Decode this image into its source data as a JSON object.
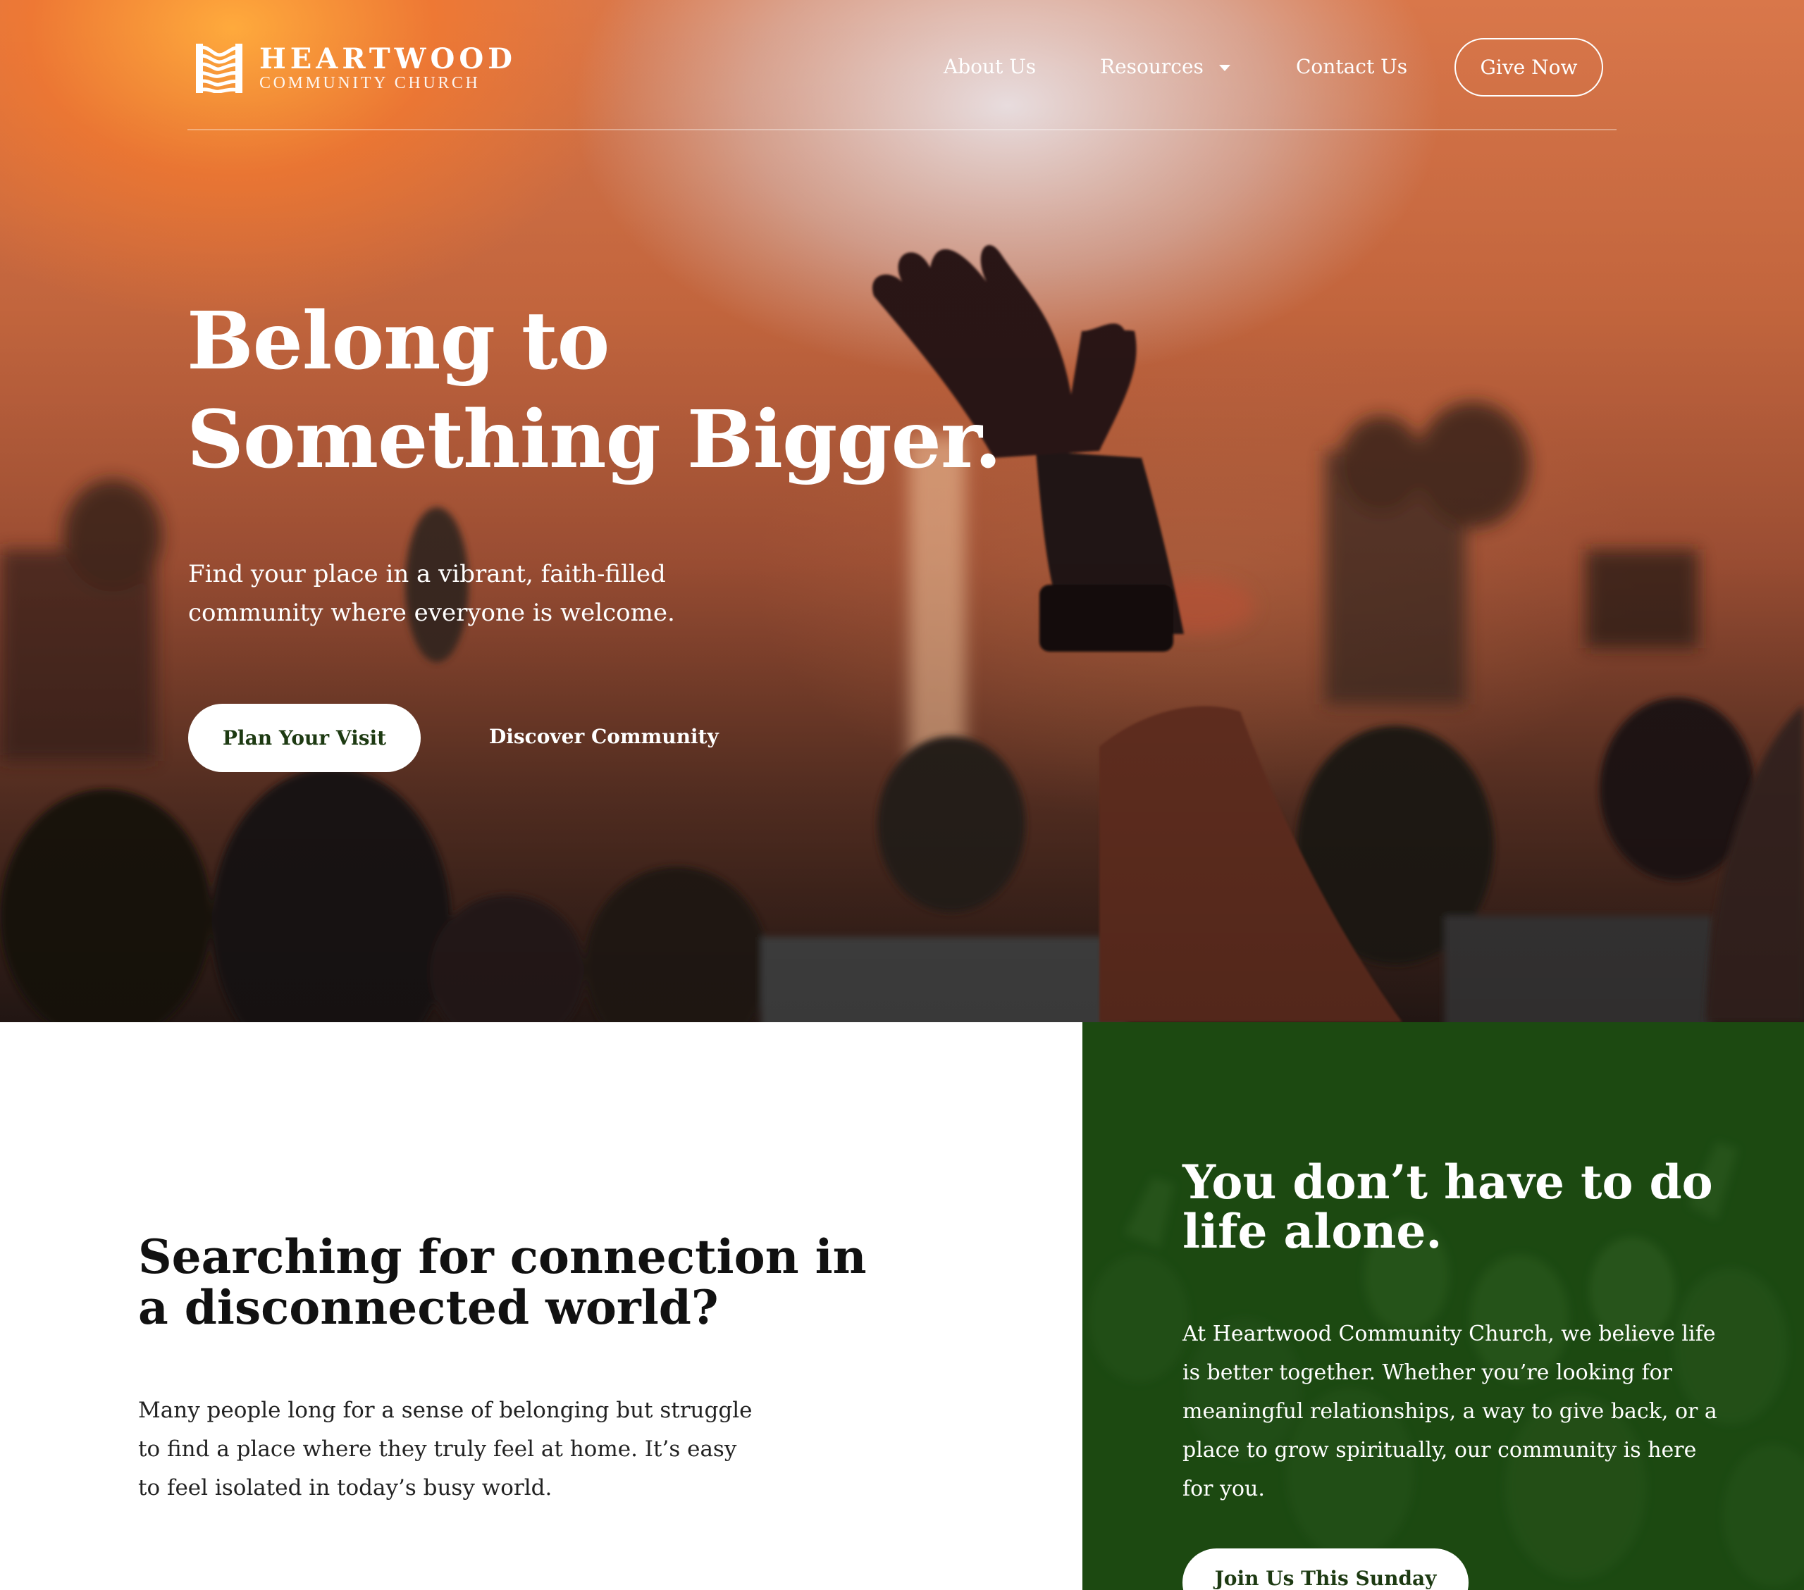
{
  "brand": {
    "name": "HEARTWOOD",
    "subtitle": "COMMUNITY CHURCH"
  },
  "nav": {
    "about": "About Us",
    "resources": "Resources",
    "contact": "Contact Us",
    "give": "Give Now"
  },
  "hero": {
    "title_line1": "Belong to",
    "title_line2": "Something Bigger.",
    "subtitle_line1": "Find your place in a vibrant, faith-filled",
    "subtitle_line2": "community where everyone is welcome.",
    "primary_cta": "Plan Your Visit",
    "secondary_cta": "Discover Community"
  },
  "connection": {
    "title_line1": "Searching for connection in",
    "title_line2": "a disconnected world?",
    "body": "Many people long for a sense of belonging but struggle to find a place where they truly feel at home. It’s easy to feel isolated in today’s busy world."
  },
  "together": {
    "title_line1": "You don’t have to do",
    "title_line2": "life alone.",
    "body": "At Heartwood Community Church, we believe life is better together. Whether you’re looking for meaningful relationships, a way to give back, or a place to grow spiritually, our community is here for you.",
    "cta": "Join Us This Sunday"
  },
  "colors": {
    "accent_green": "#1c4a12",
    "button_text_green": "#1d3a12",
    "hero_orange": "#d9774a",
    "white": "#ffffff"
  },
  "icons": {
    "logo": "heartwood-logo-icon",
    "dropdown": "chevron-down-icon"
  }
}
